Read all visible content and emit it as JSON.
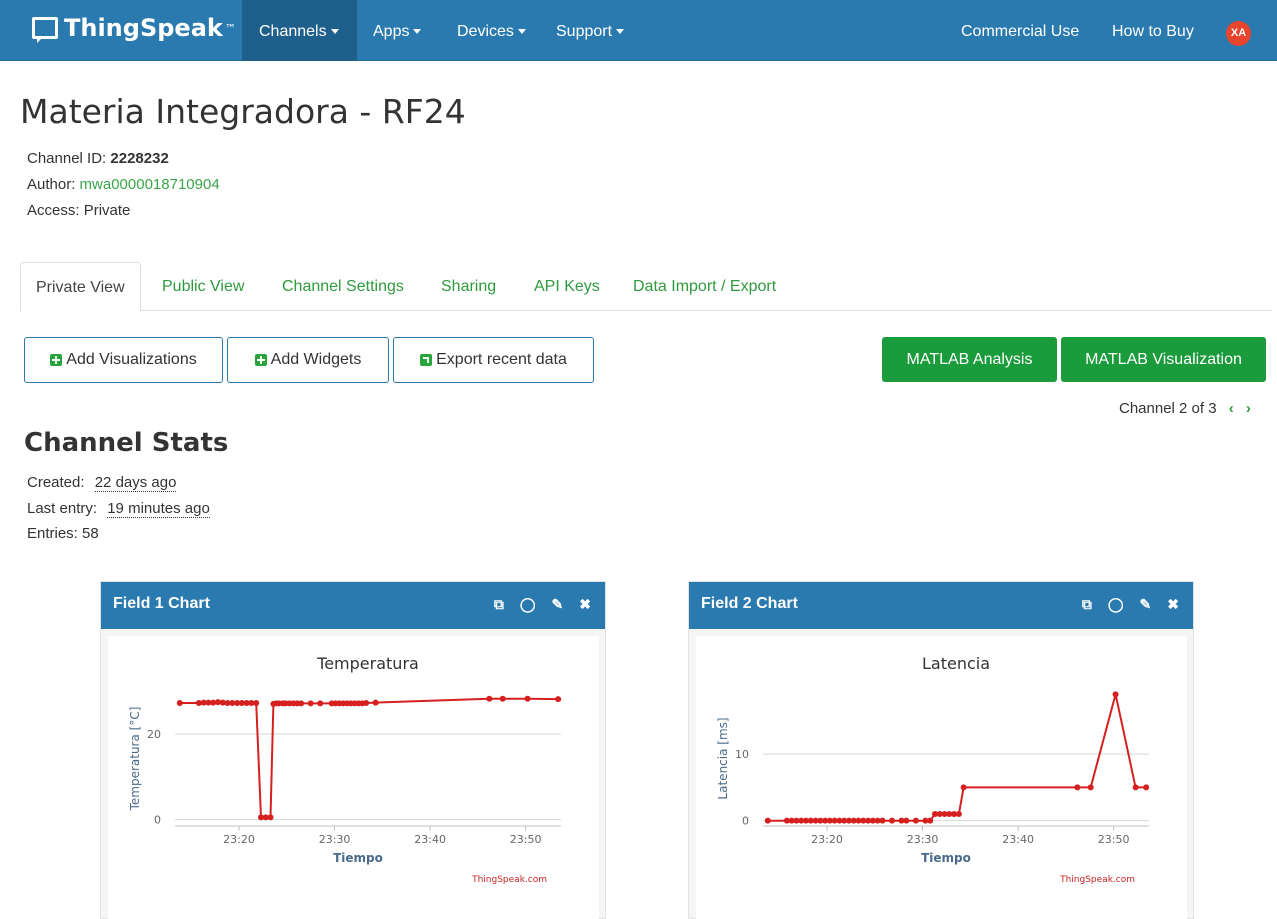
{
  "nav": {
    "brand": "ThingSpeak",
    "brand_tm": "™",
    "channels": "Channels",
    "apps": "Apps",
    "devices": "Devices",
    "support": "Support",
    "commercial_use": "Commercial Use",
    "how_to_buy": "How to Buy",
    "avatar_initials": "XA"
  },
  "channel": {
    "title": "Materia Integradora - RF24",
    "id_label": "Channel ID:",
    "id_value": "2228232",
    "author_label": "Author:",
    "author_value": "mwa0000018710904",
    "access_label": "Access:",
    "access_value": "Private"
  },
  "tabs": [
    {
      "label": "Private View",
      "active": true
    },
    {
      "label": "Public View"
    },
    {
      "label": "Channel Settings"
    },
    {
      "label": "Sharing"
    },
    {
      "label": "API Keys"
    },
    {
      "label": "Data Import / Export"
    }
  ],
  "buttons": {
    "add_visualizations": "Add Visualizations",
    "add_widgets": "Add Widgets",
    "export_recent": "Export recent data",
    "matlab_analysis": "MATLAB Analysis",
    "matlab_visualization": "MATLAB Visualization"
  },
  "pager": {
    "text": "Channel 2 of 3",
    "prev": "‹",
    "next": "›"
  },
  "stats": {
    "title": "Channel Stats",
    "created_label": "Created:",
    "created_value": "22 days ago",
    "last_entry_label": "Last entry:",
    "last_entry_value": "19 minutes ago",
    "entries_label": "Entries:",
    "entries_value": "58"
  },
  "panels": [
    {
      "title": "Field 1 Chart"
    },
    {
      "title": "Field 2 Chart"
    }
  ],
  "colors": {
    "navbar": "#2a7ab0",
    "series": "#d62020",
    "accent_green": "#1a9b3c",
    "axis_label": "#4a6a8a"
  },
  "chart_data": [
    {
      "type": "line",
      "title": "Temperatura",
      "xlabel": "Tiempo",
      "ylabel": "Temperatura [°C]",
      "credit": "ThingSpeak.com",
      "x_ticks": [
        "23:20",
        "23:30",
        "23:40",
        "23:50"
      ],
      "y_ticks": [
        0,
        20
      ],
      "xlim": [
        13.3,
        53.7
      ],
      "ylim": [
        -1.5,
        30
      ],
      "grid": true,
      "series": [
        {
          "x": [
            13.8,
            15.8,
            16.3,
            16.8,
            17.3,
            17.8,
            18.3,
            18.8,
            19.3,
            19.8,
            20.3,
            20.8,
            21.3,
            21.8,
            22.3,
            22.8,
            23.3,
            23.6,
            23.9,
            24.2,
            24.6,
            24.9,
            25.3,
            25.7,
            26.1,
            26.5,
            27.5,
            28.5,
            29.7,
            30.1,
            30.5,
            30.9,
            31.3,
            31.7,
            32.1,
            32.5,
            32.9,
            33.3,
            34.3,
            46.2,
            47.6,
            50.2,
            53.4
          ],
          "y": [
            27.2,
            27.2,
            27.3,
            27.3,
            27.3,
            27.4,
            27.3,
            27.2,
            27.2,
            27.2,
            27.2,
            27.2,
            27.2,
            27.2,
            0.5,
            0.5,
            0.5,
            27.0,
            27.1,
            27.1,
            27.1,
            27.1,
            27.1,
            27.1,
            27.1,
            27.1,
            27.1,
            27.1,
            27.1,
            27.1,
            27.1,
            27.1,
            27.1,
            27.1,
            27.1,
            27.1,
            27.1,
            27.2,
            27.3,
            28.2,
            28.2,
            28.2,
            28.1
          ]
        }
      ]
    },
    {
      "type": "line",
      "title": "Latencia",
      "xlabel": "Tiempo",
      "ylabel": "Latencia [ms]",
      "credit": "ThingSpeak.com",
      "x_ticks": [
        "23:20",
        "23:30",
        "23:40",
        "23:50"
      ],
      "y_ticks": [
        0,
        10
      ],
      "xlim": [
        13.3,
        53.7
      ],
      "ylim": [
        -0.8,
        19.5
      ],
      "grid": true,
      "series": [
        {
          "x": [
            13.8,
            15.8,
            16.3,
            16.8,
            17.3,
            17.8,
            18.3,
            18.8,
            19.3,
            19.8,
            20.3,
            20.8,
            21.3,
            21.8,
            22.3,
            22.8,
            23.3,
            23.8,
            24.3,
            24.8,
            25.3,
            25.8,
            26.8,
            27.8,
            28.3,
            29.3,
            30.3,
            30.8,
            31.3,
            31.8,
            32.3,
            32.8,
            33.3,
            33.8,
            34.3,
            46.2,
            47.6,
            50.2,
            52.3,
            53.4
          ],
          "y": [
            0,
            0,
            0,
            0,
            0,
            0,
            0,
            0,
            0,
            0,
            0,
            0,
            0,
            0,
            0,
            0,
            0,
            0,
            0,
            0,
            0,
            0,
            0,
            0,
            0,
            0,
            0,
            0,
            1,
            1,
            1,
            1,
            1,
            1,
            5,
            5,
            5,
            19,
            5,
            5
          ]
        }
      ]
    }
  ]
}
